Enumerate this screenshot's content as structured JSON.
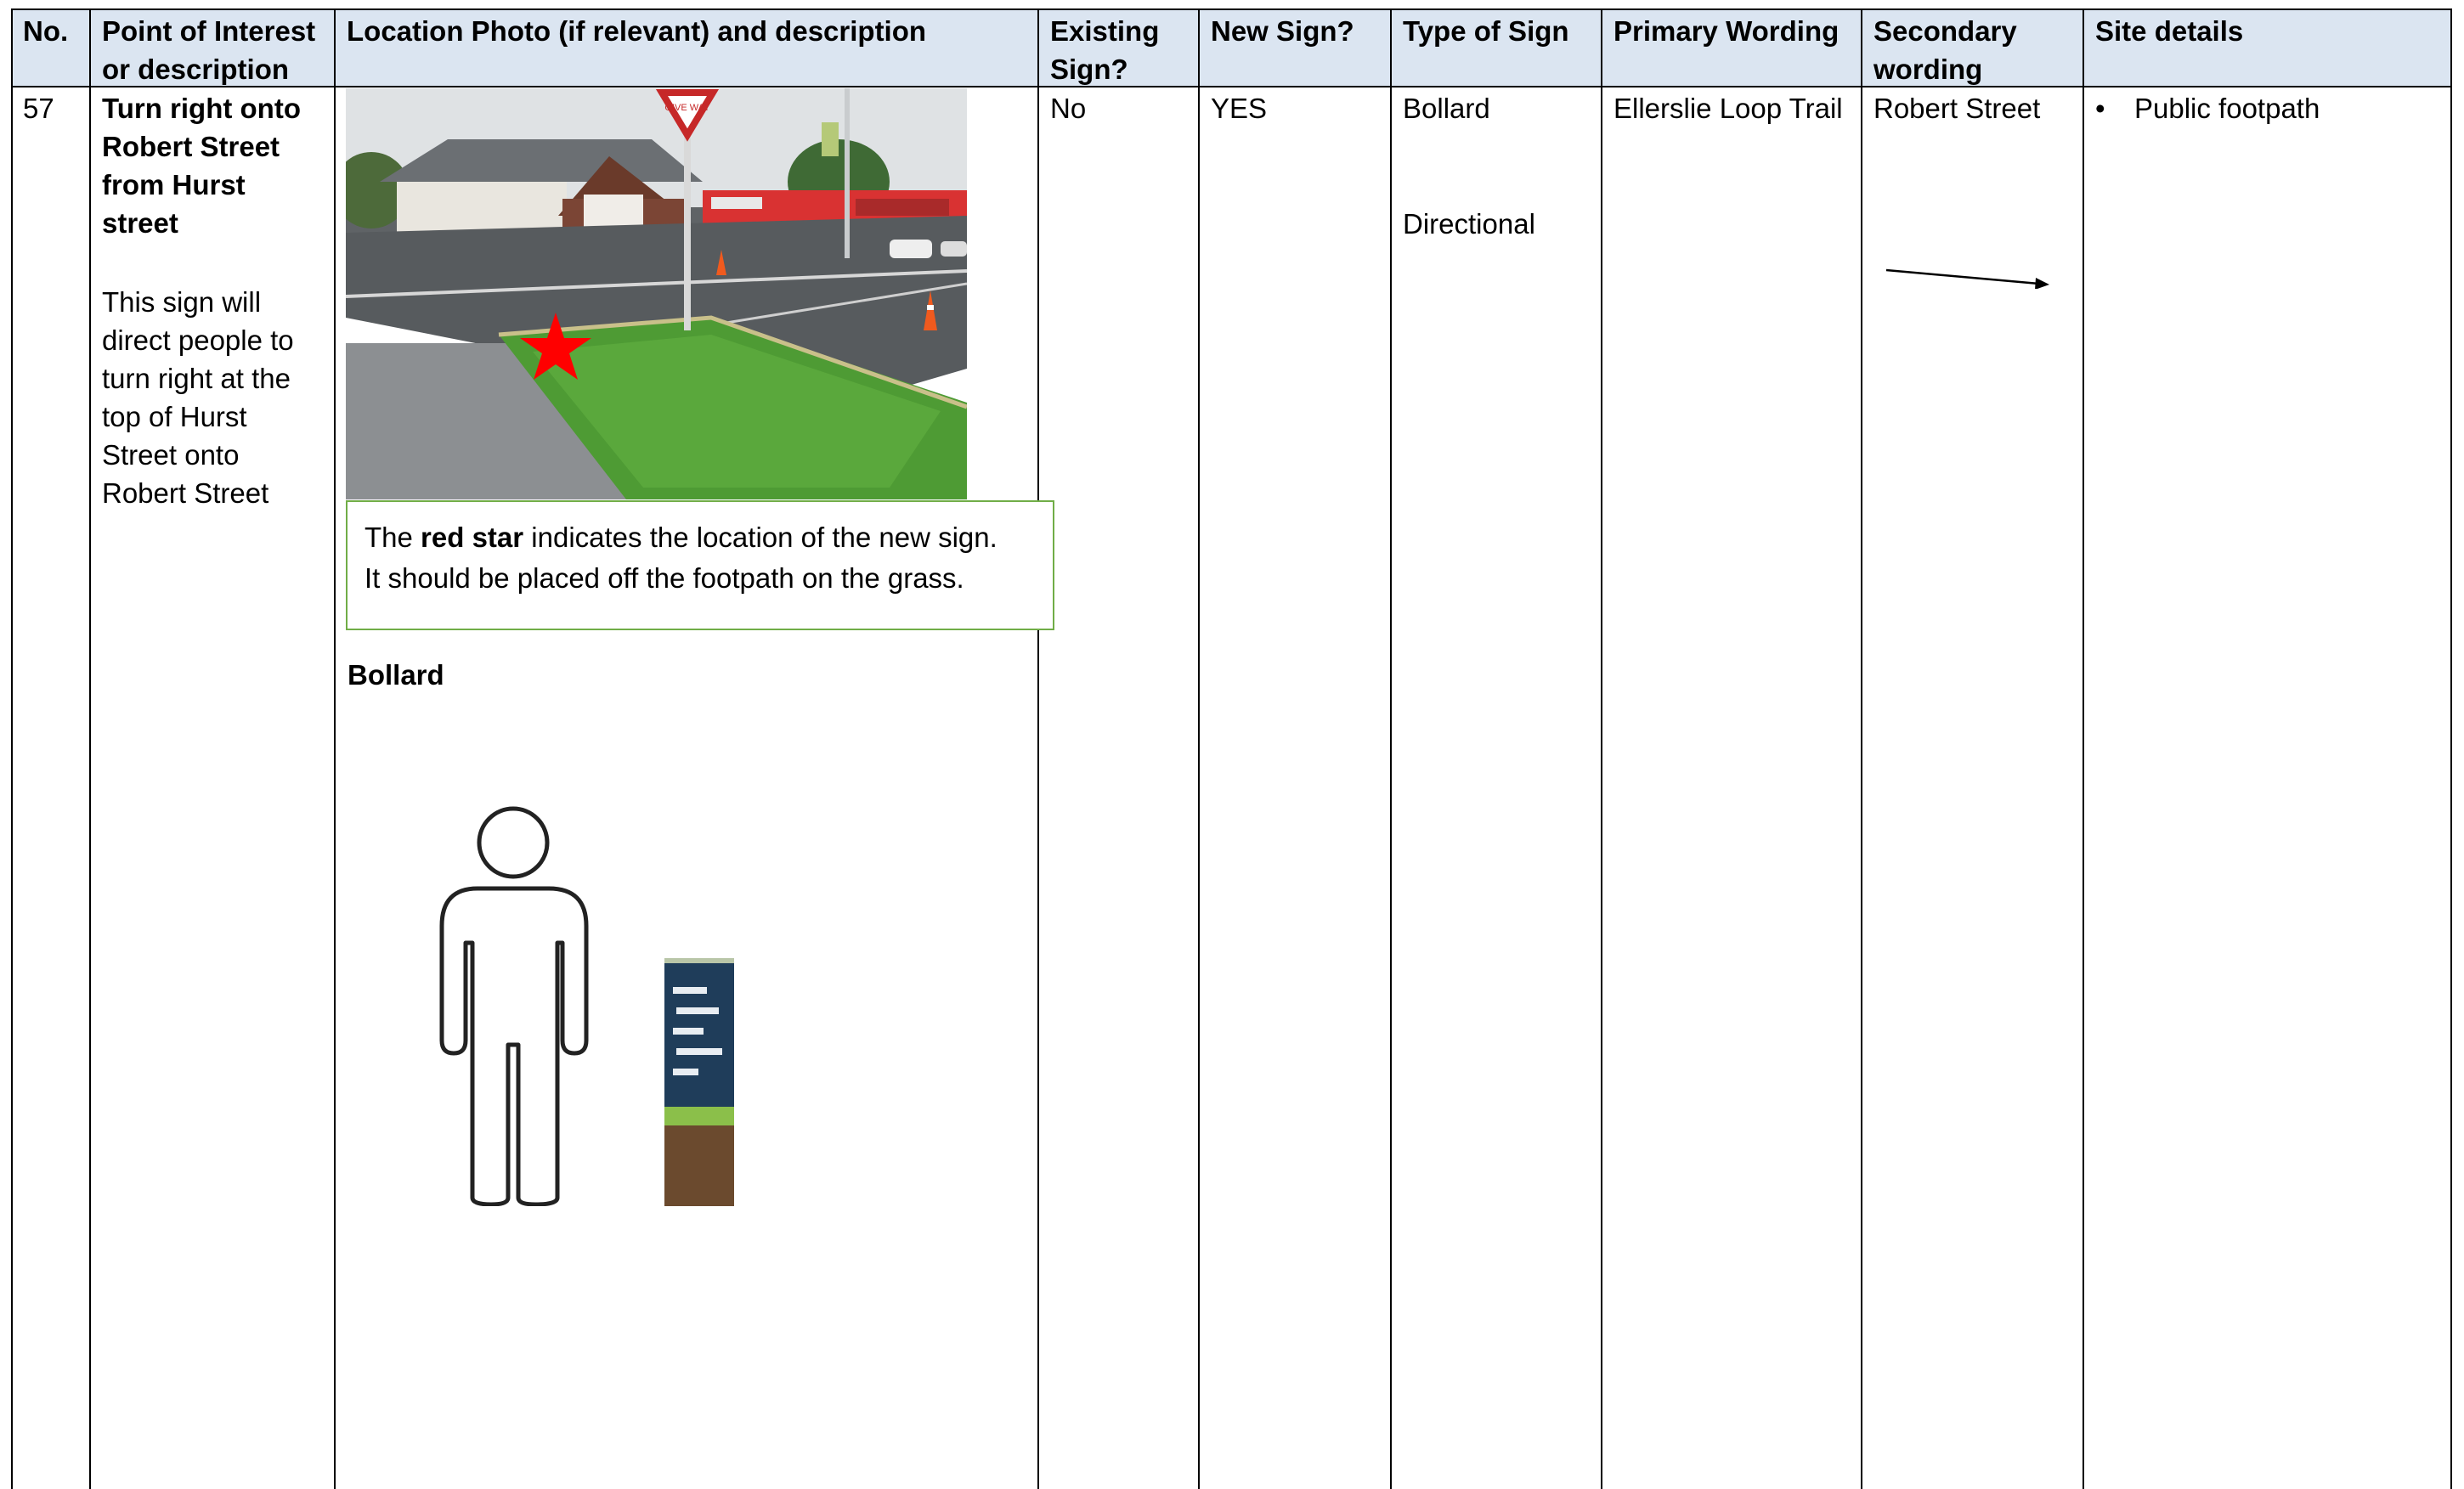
{
  "headers": {
    "no": "No.",
    "poi": "Point of Interest or description",
    "photo": "Location Photo (if relevant) and description",
    "existing": "Existing Sign?",
    "new_sign": "New Sign?",
    "type": "Type of Sign",
    "primary": "Primary Wording",
    "secondary": "Secondary wording",
    "site": "Site details"
  },
  "row": {
    "no": "57",
    "poi_title_lines": [
      "Turn right onto",
      "Robert Street",
      "from Hurst",
      "street"
    ],
    "poi_desc_lines": [
      "This sign will",
      "direct people to",
      "turn right at the",
      "top of Hurst",
      "Street onto",
      "Robert Street"
    ],
    "callout": {
      "pre": "The ",
      "bold": "red star",
      "post": " indicates the location of the new sign.",
      "line2": "It should be placed off the footpath on the grass."
    },
    "diagram_label": "Bollard",
    "existing": "No",
    "new_sign": "YES",
    "type_1": "Bollard",
    "type_2": "Directional",
    "primary": "Ellerslie Loop Trail",
    "secondary": "Robert Street",
    "secondary_icon": "right-arrow-icon",
    "site_details": [
      "Public footpath"
    ]
  },
  "photo_sign_text": "GIVE WAY",
  "colors": {
    "header_bg": "#dbe5f1",
    "callout_border": "#70ad47",
    "star": "#ff0000",
    "bollard_panel": "#1f3d5a",
    "bollard_band": "#8bbf4a",
    "bollard_base": "#6b4a2e"
  }
}
